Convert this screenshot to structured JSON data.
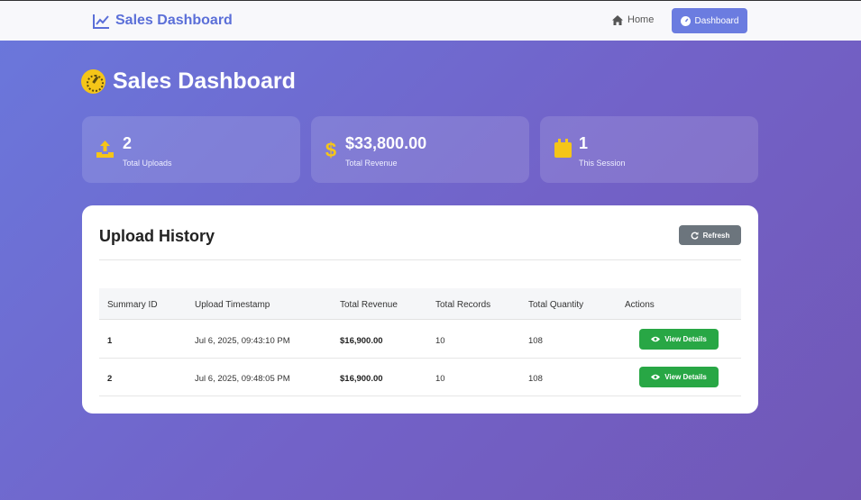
{
  "navbar": {
    "brand": "Sales Dashboard",
    "home_label": "Home",
    "dashboard_label": "Dashboard"
  },
  "page": {
    "title": "Sales Dashboard"
  },
  "stats": [
    {
      "value": "2",
      "label": "Total Uploads",
      "icon": "upload-icon"
    },
    {
      "value": "$33,800.00",
      "label": "Total Revenue",
      "icon": "dollar-icon"
    },
    {
      "value": "1",
      "label": "This Session",
      "icon": "calendar-icon"
    }
  ],
  "history": {
    "title": "Upload History",
    "refresh_label": "Refresh",
    "columns": [
      "Summary ID",
      "Upload Timestamp",
      "Total Revenue",
      "Total Records",
      "Total Quantity",
      "Actions"
    ],
    "rows": [
      {
        "id": "1",
        "timestamp": "Jul 6, 2025, 09:43:10 PM",
        "revenue": "$16,900.00",
        "records": "10",
        "quantity": "108",
        "action": "View Details"
      },
      {
        "id": "2",
        "timestamp": "Jul 6, 2025, 09:48:05 PM",
        "revenue": "$16,900.00",
        "records": "10",
        "quantity": "108",
        "action": "View Details"
      }
    ]
  },
  "colors": {
    "accent": "#6b7ce0",
    "icon_yellow": "#f5c518",
    "success": "#28a745",
    "secondary": "#6c757d"
  }
}
